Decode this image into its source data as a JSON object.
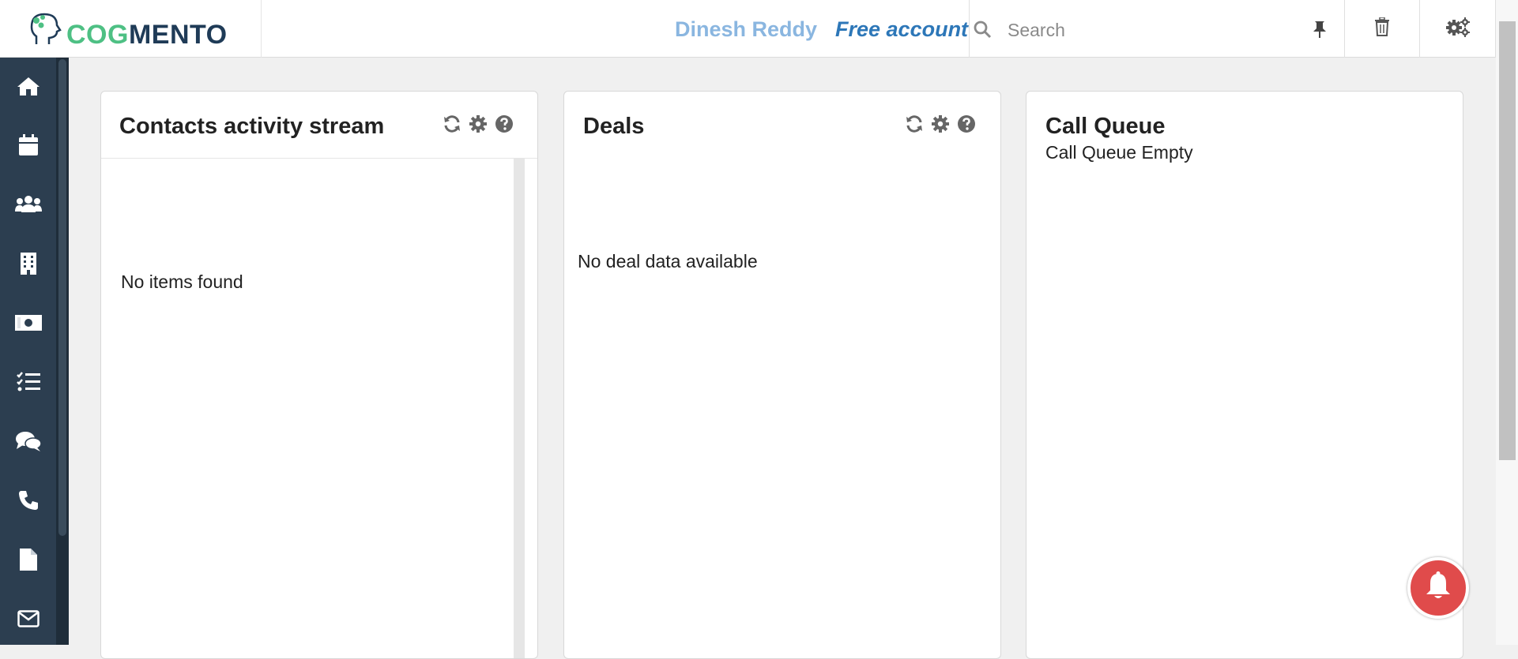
{
  "header": {
    "logo_text_green": "COG",
    "logo_text_dark": "MENTO",
    "user_name": "Dinesh Reddy",
    "account_type": "Free account",
    "search_placeholder": "Search"
  },
  "sidebar": {
    "items": [
      {
        "icon": "home-icon"
      },
      {
        "icon": "calendar-icon"
      },
      {
        "icon": "contacts-icon"
      },
      {
        "icon": "companies-icon"
      },
      {
        "icon": "deals-money-icon"
      },
      {
        "icon": "tasks-icon"
      },
      {
        "icon": "cases-comments-icon"
      },
      {
        "icon": "phone-icon"
      },
      {
        "icon": "documents-icon"
      },
      {
        "icon": "email-icon"
      }
    ]
  },
  "panels": {
    "activity": {
      "title": "Contacts activity stream",
      "message": "No items found"
    },
    "deals": {
      "title": "Deals",
      "message": "No deal data available"
    },
    "call_queue": {
      "title": "Call Queue",
      "message": "Call Queue Empty"
    }
  },
  "colors": {
    "sidebar_bg": "#2c3e50",
    "brand_green": "#4ec084",
    "brand_dark": "#1f3b57",
    "user_name": "#8ab6e0",
    "account": "#2d77b8",
    "bell": "#e04b4b"
  }
}
